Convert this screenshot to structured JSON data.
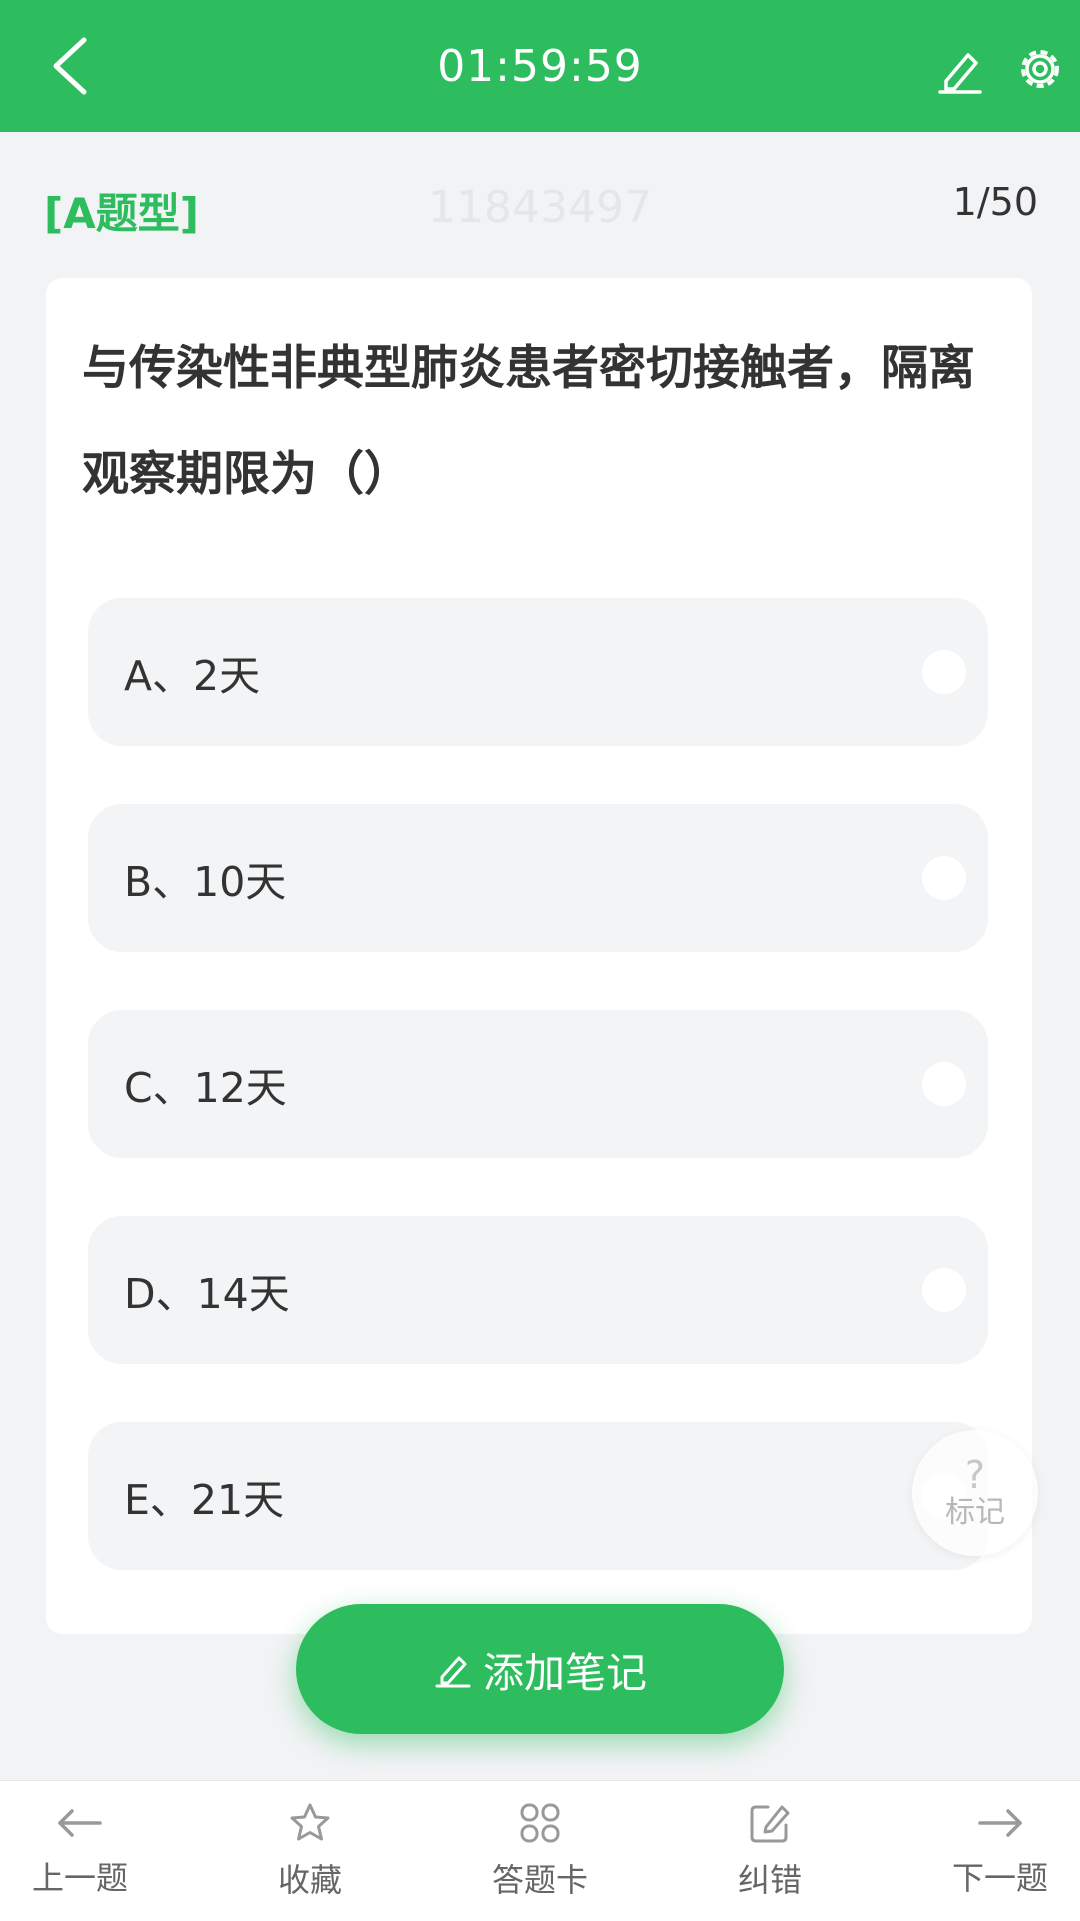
{
  "header": {
    "timer": "01:59:59",
    "bg_color": "#2dbd5e",
    "icons": [
      "back-chevron-icon",
      "pen-icon",
      "gear-icon"
    ]
  },
  "meta": {
    "question_type": "[A题型]",
    "question_id": "11843497",
    "progress": "1/50"
  },
  "question": {
    "text": "与传染性非典型肺炎患者密切接触者，隔离观察期限为（）"
  },
  "options": [
    {
      "label": "A、2天"
    },
    {
      "label": "B、10天"
    },
    {
      "label": "C、12天"
    },
    {
      "label": "D、14天"
    },
    {
      "label": "E、21天"
    }
  ],
  "mark": {
    "symbol": "?",
    "label": "标记"
  },
  "note_button": {
    "label": "添加笔记"
  },
  "bottom_nav": [
    {
      "label": "上一题",
      "icon": "arrow-left-icon"
    },
    {
      "label": "收藏",
      "icon": "star-icon"
    },
    {
      "label": "答题卡",
      "icon": "grid-icon"
    },
    {
      "label": "纠错",
      "icon": "edit-square-icon"
    },
    {
      "label": "下一题",
      "icon": "arrow-right-icon"
    }
  ]
}
